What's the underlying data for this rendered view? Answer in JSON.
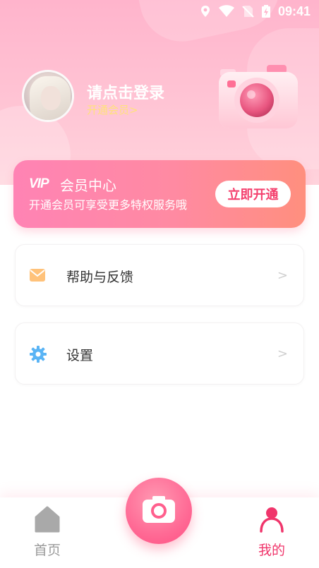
{
  "status_bar": {
    "time": "09:41",
    "icons": [
      "location-icon",
      "wifi-icon",
      "no-sim-icon",
      "battery-charging-icon"
    ]
  },
  "profile": {
    "login_prompt": "请点击登录",
    "vip_link": "开通会员>"
  },
  "vip_card": {
    "logo": "VIP",
    "title": "会员中心",
    "description": "开通会员可享受更多特权服务哦",
    "button_label": "立即开通"
  },
  "menu": [
    {
      "label": "帮助与反馈",
      "icon": "mail-icon",
      "arrow": ">"
    },
    {
      "label": "设置",
      "icon": "gear-icon",
      "arrow": ">"
    }
  ],
  "tabbar": {
    "home_label": "首页",
    "mine_label": "我的",
    "center_icon": "camera-icon"
  },
  "colors": {
    "accent": "#f0356b",
    "header_pink": "#ffb4cc",
    "vip_gradient_start": "#ff83b4",
    "vip_gradient_end": "#ff8f7e",
    "vip_link": "#ffe27a"
  }
}
